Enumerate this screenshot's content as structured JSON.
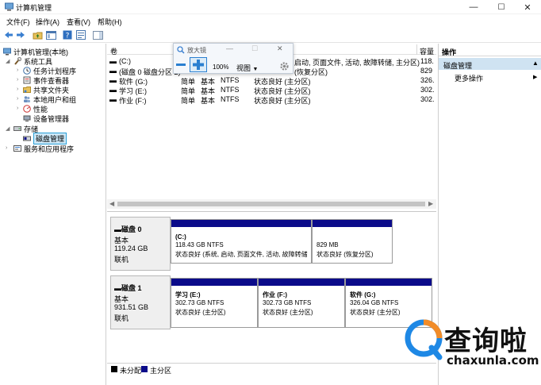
{
  "window": {
    "title": "计算机管理",
    "minimize_glyph": "—",
    "maximize_glyph": "☐",
    "close_glyph": "✕"
  },
  "menu": {
    "file": "文件(F)",
    "action": "操作(A)",
    "view": "查看(V)",
    "help": "帮助(H)"
  },
  "tree": {
    "root": "计算机管理(本地)",
    "system_tools": "系统工具",
    "task_scheduler": "任务计划程序",
    "event_viewer": "事件查看器",
    "shared_folders": "共享文件夹",
    "local_users": "本地用户和组",
    "performance": "性能",
    "device_manager": "设备管理器",
    "storage": "存储",
    "disk_management": "磁盘管理",
    "services_apps": "服务和应用程序"
  },
  "volume_list": {
    "headers": {
      "volume": "卷",
      "capacity": "容量"
    },
    "rows": [
      {
        "volume": "(C:)",
        "capacity": "118."
      },
      {
        "volume": "(磁盘 0 磁盘分区 2)",
        "capacity": "829"
      },
      {
        "volume": "软件 (G:)",
        "layout": "简单",
        "type": "基本",
        "fs": "NTFS",
        "status": "状态良好 (主分区)",
        "capacity": "326."
      },
      {
        "volume": "学习 (E:)",
        "layout": "简单",
        "type": "基本",
        "fs": "NTFS",
        "status": "状态良好 (主分区)",
        "capacity": "302."
      },
      {
        "volume": "作业 (F:)",
        "layout": "简单",
        "type": "基本",
        "fs": "NTFS",
        "status": "状态良好 (主分区)",
        "capacity": "302."
      }
    ],
    "row0_status_tail": "启动, 页面文件, 活动, 故障转储, 主分区)",
    "row1_tail": "(恢复分区)"
  },
  "magnifier": {
    "title": "放大镜",
    "zoom": "100%",
    "view_label": "视图"
  },
  "actions": {
    "header": "操作",
    "subheader": "磁盘管理",
    "more": "更多操作"
  },
  "disks": [
    {
      "name": "磁盘 0",
      "type": "基本",
      "size": "119.24 GB",
      "state": "联机",
      "partitions": [
        {
          "label": "(C:)",
          "size": "118.43 GB NTFS",
          "status": "状态良好 (系统, 启动, 页面文件, 活动, 故障转储"
        },
        {
          "label": "",
          "size": "829 MB",
          "status": "状态良好 (恢复分区)"
        }
      ]
    },
    {
      "name": "磁盘 1",
      "type": "基本",
      "size": "931.51 GB",
      "state": "联机",
      "partitions": [
        {
          "label": "学习 (E:)",
          "size": "302.73 GB NTFS",
          "status": "状态良好 (主分区)"
        },
        {
          "label": "作业 (F:)",
          "size": "302.73 GB NTFS",
          "status": "状态良好 (主分区)"
        },
        {
          "label": "软件 (G:)",
          "size": "326.04 GB NTFS",
          "status": "状态良好 (主分区)"
        }
      ]
    }
  ],
  "legend": {
    "unallocated": "未分配",
    "primary": "主分区"
  },
  "watermark": {
    "brand": "查询啦",
    "domain": "chaxunla.com"
  },
  "colors": {
    "partition_bar": "#0b0b8a",
    "selection": "#2a9fd6",
    "watermark_blue": "#1e88e5",
    "watermark_orange": "#f28c28"
  }
}
